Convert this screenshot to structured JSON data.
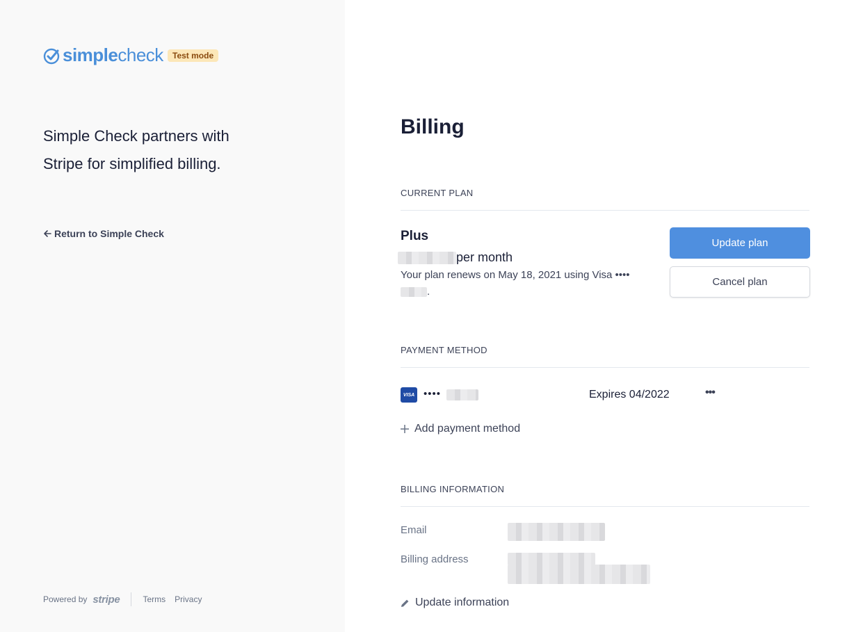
{
  "brand": {
    "name_part1": "simple",
    "name_part2": "check",
    "badge": "Test mode",
    "accent_color": "#4a8fd9"
  },
  "sidebar": {
    "tagline": "Simple Check partners with Stripe for simplified billing.",
    "return_link": "Return to Simple Check",
    "footer": {
      "powered_by": "Powered by",
      "stripe": "stripe",
      "terms": "Terms",
      "privacy": "Privacy"
    }
  },
  "main": {
    "title": "Billing",
    "current_plan": {
      "heading": "CURRENT PLAN",
      "plan_name": "Plus",
      "price_suffix": "per month",
      "renew_text": "Your plan renews on May 18, 2021 using Visa ••••",
      "renew_end": ".",
      "update_button": "Update plan",
      "cancel_button": "Cancel plan"
    },
    "payment_method": {
      "heading": "PAYMENT METHOD",
      "card_brand": "VISA",
      "card_dots": "••••",
      "expires": "Expires 04/2022",
      "more": "•••",
      "add_label": "Add payment method"
    },
    "billing_info": {
      "heading": "BILLING INFORMATION",
      "email_label": "Email",
      "address_label": "Billing address",
      "update_label": "Update information"
    }
  }
}
